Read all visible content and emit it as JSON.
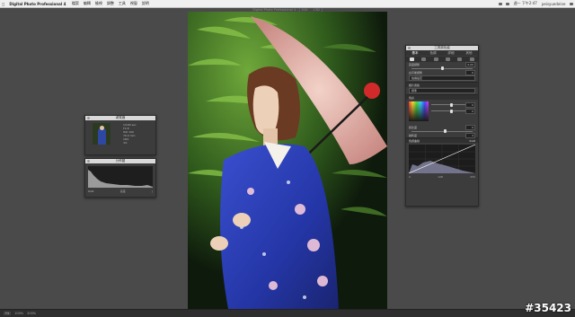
{
  "menubar": {
    "app_name": "Digital Photo Professional 4",
    "menus": [
      "檔案",
      "編輯",
      "檢視",
      "調整",
      "工具",
      "視窗",
      "說明"
    ],
    "status_right": [
      "週一 下午2:47",
      "peisyuedeine"
    ]
  },
  "window": {
    "title": "Digital Photo Professional 4 - [ 1DX.CR2 ]"
  },
  "navigator": {
    "title": "導覽器",
    "info_lines": [
      "1/160 sec",
      "F2.8",
      "ISO 100",
      "70.0 mm",
      "1DX",
      "±0",
      "Auto",
      "Standard"
    ]
  },
  "histogram": {
    "title": "分佈圖",
    "footer": [
      "RGB",
      "亮度",
      "|"
    ]
  },
  "tool_palette": {
    "title": "工具調色盤",
    "tabs": [
      "基本",
      "色調",
      "詳細",
      "其他"
    ],
    "icons": [
      "basic-icon",
      "tone-icon",
      "color-icon",
      "detail-icon",
      "lens-icon",
      "crop-icon"
    ],
    "brightness_label": "亮度調整",
    "brightness_value": "0.00",
    "wb_label": "白平衡調整",
    "wb_value": "0",
    "wb_option": "拍攝設定",
    "picture_style_label": "相片風格",
    "picture_style_option": "標準",
    "color_label": "色彩",
    "hue_value": "0",
    "saturation_value": "0",
    "contrast_label": "對比度",
    "contrast_value": "0",
    "sharpness_label": "銳利度",
    "sharpness_value": "3",
    "curve_section": "色調曲線",
    "curve_mode": "RGB",
    "curve_foot": [
      "0",
      "128",
      "255"
    ]
  },
  "bottombar": {
    "zoom": "Fit",
    "segments": [
      "100%",
      "200%"
    ]
  },
  "watermark": "#35423"
}
